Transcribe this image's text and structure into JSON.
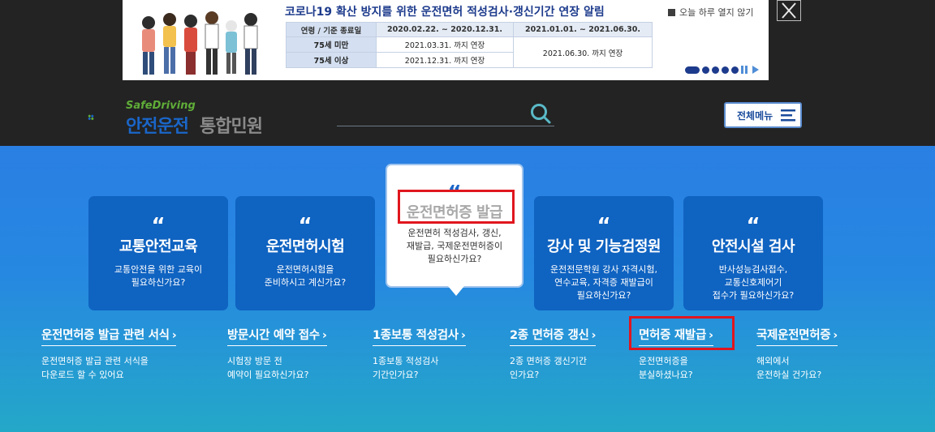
{
  "popup": {
    "title": "코로나19 확산 방지를 위한 운전면허 적성검사·갱신기간 연장 알림",
    "table": {
      "headers": [
        "연령 / 기준 종료일",
        "2020.02.22. ~ 2020.12.31.",
        "2021.01.01. ~ 2021.06.30."
      ],
      "rows": [
        {
          "label": "75세 미만",
          "col1": "2021.03.31. 까지 연장"
        },
        {
          "label": "75세 이상",
          "col1": "2021.12.31. 까지 연장"
        }
      ],
      "merged_col2": "2021.06.30. 까지 연장"
    },
    "no_show_today": "오늘 하루 열지 않기",
    "close_icon": "close-icon"
  },
  "header": {
    "logo_en": "SafeDriving",
    "logo_ko": "안전운전",
    "logo_sub": "통합민원",
    "search_placeholder": "",
    "menu_label": "전체메뉴"
  },
  "cards": [
    {
      "title": "교통안전교육",
      "desc": "교통안전을 위한 교육이\n필요하신가요?"
    },
    {
      "title": "운전면허시험",
      "desc": "운전면허시험을\n준비하시고 계신가요?"
    },
    {
      "title": "운전면허증 발급",
      "desc": "운전면허 적성검사, 갱신,\n재발급, 국제운전면허증이\n필요하신가요?"
    },
    {
      "title": "강사 및 기능검정원",
      "desc": "운전전문학원 강사 자격시험,\n연수교육, 자격증 재발급이\n필요하신가요?"
    },
    {
      "title": "안전시설 검사",
      "desc": "반사성능검사접수,\n교통신호제어기\n접수가 필요하신가요?"
    }
  ],
  "quote_mark": "“",
  "links": [
    {
      "title": "운전면허증 발급 관련 서식",
      "desc": "운전면허증 발급 관련 서식을\n다운로드 할 수 있어요"
    },
    {
      "title": "방문시간 예약 접수",
      "desc": "시험장 방문 전\n예약이 필요하신가요?"
    },
    {
      "title": "1종보통 적성검사",
      "desc": "1종보통 적성검사\n기간인가요?"
    },
    {
      "title": "2종 면허증 갱신",
      "desc": "2종 면허증 갱신기간\n인가요?"
    },
    {
      "title": "면허증 재발급",
      "desc": "운전면허증을\n분실하셨나요?"
    },
    {
      "title": "국제운전면허증",
      "desc": "해외에서\n운전하실 건가요?"
    }
  ],
  "arrow": "›",
  "colors": {
    "accent": "#1a66c9",
    "card": "#0f63c1",
    "highlight": "#e0161e"
  }
}
